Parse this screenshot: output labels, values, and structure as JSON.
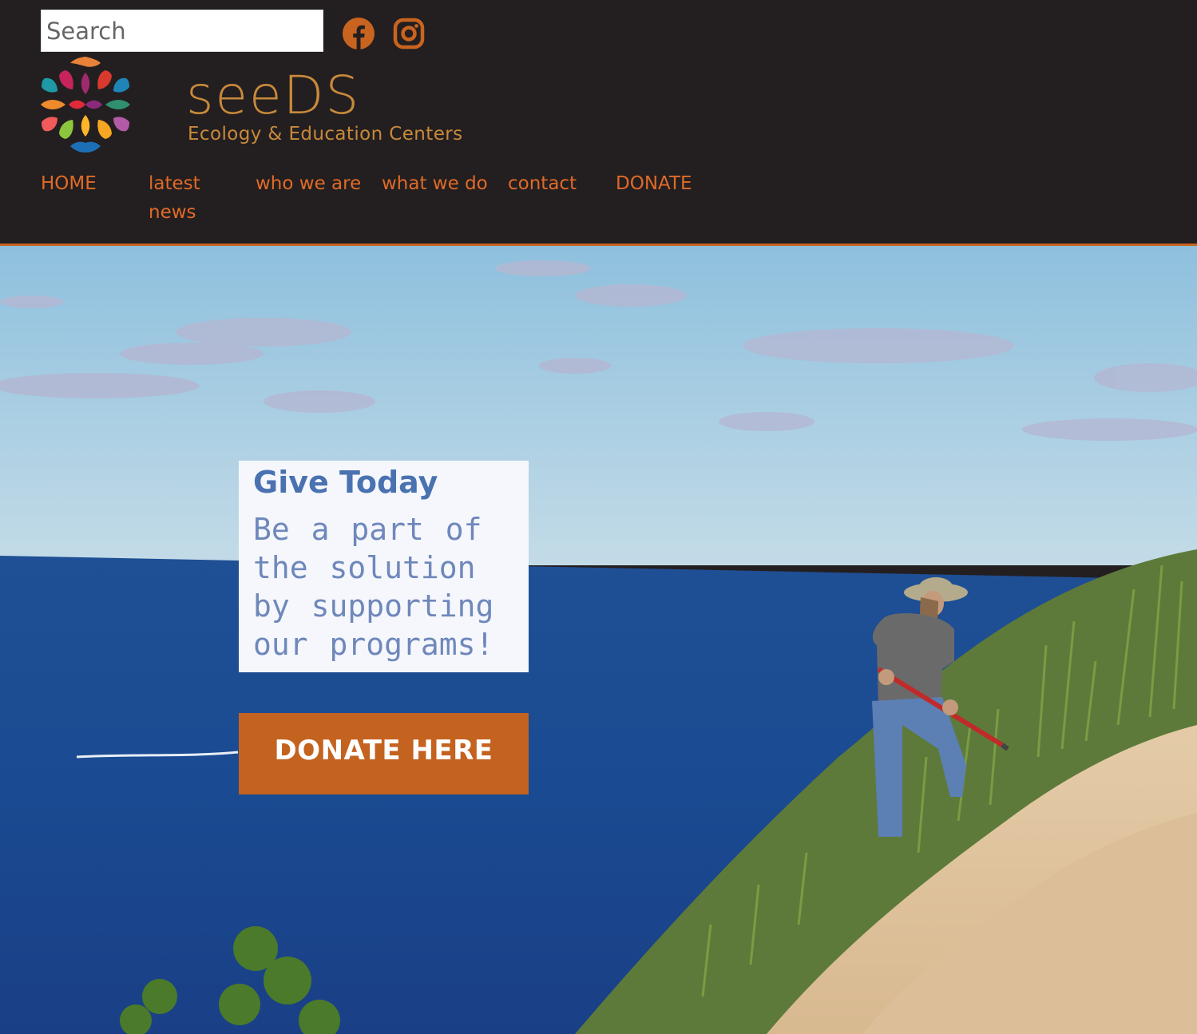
{
  "search": {
    "placeholder": "Search"
  },
  "social": [
    {
      "icon": "facebook-icon"
    },
    {
      "icon": "instagram-icon"
    }
  ],
  "brand": {
    "name": "seeDS",
    "tagline": "Ecology & Education Centers",
    "text_color": "#c8893a"
  },
  "nav": {
    "home": "HOME",
    "latest_news_line1": "latest",
    "latest_news_line2": "news",
    "who_we_are": "who we are",
    "what_we_do": "what we do",
    "contact": "contact",
    "donate": "DONATE"
  },
  "hero": {
    "title": "Give Today",
    "text": "Be a part of the solution by supporting our programs!",
    "button": "DONATE HERE"
  },
  "colors": {
    "header_bg": "#231f20",
    "accent": "#c4621f",
    "nav_text": "#e06a28",
    "title_blue": "#4a72b0"
  }
}
